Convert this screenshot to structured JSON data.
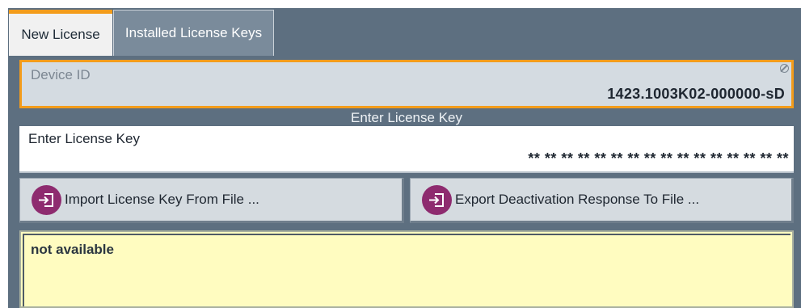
{
  "tabs": [
    {
      "label": "New License",
      "active": true
    },
    {
      "label": "Installed License Keys",
      "active": false
    }
  ],
  "device": {
    "label": "Device ID",
    "value": "1423.1003K02-000000-sD",
    "icon": "lock-icon"
  },
  "section_header": "Enter License Key",
  "license_key": {
    "label": "Enter License Key",
    "value": "** ** ** ** ** ** ** ** ** ** ** ** ** ** ** **"
  },
  "buttons": {
    "import_label": "Import License Key From File ...",
    "export_label": "Export Deactivation Response To File ...",
    "icon": "import-file-icon"
  },
  "message": {
    "text": "not available"
  },
  "colors": {
    "accent": "#f39c1b",
    "header_bg": "#5d6f80",
    "icon_bg": "#8e2b6f",
    "message_bg": "#fffcc0"
  }
}
